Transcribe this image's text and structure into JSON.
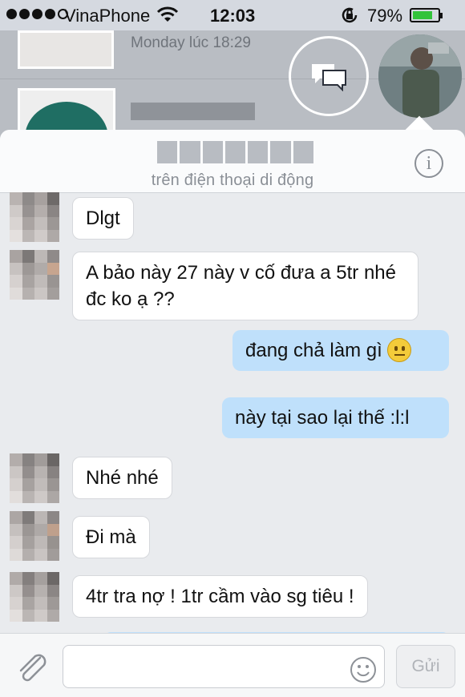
{
  "status_bar": {
    "carrier": "VinaPhone",
    "time": "12:03",
    "battery_percent": "79%",
    "battery_level": 0.79,
    "signal_bars_filled": 4
  },
  "background": {
    "date_label": "Monday lúc 18:29"
  },
  "chat": {
    "subtitle": "trên điện thoại di động",
    "messages": [
      {
        "direction": "in",
        "text": "Dlgt"
      },
      {
        "direction": "in",
        "text": "A bảo này 27 này v cố đưa a 5tr nhé đc ko ạ ??"
      },
      {
        "direction": "out",
        "text": "đang chả làm gì",
        "emoji": "neutral-face"
      },
      {
        "direction": "out",
        "text": "này tại sao lại thế :l:l"
      },
      {
        "direction": "in",
        "text": "Nhé nhé"
      },
      {
        "direction": "in",
        "text": "Đi mà"
      },
      {
        "direction": "in",
        "text": "4tr tra nợ ! 1tr cầm vào sg tiêu !"
      }
    ]
  },
  "composer": {
    "send_label": "Gửi"
  },
  "colors": {
    "outgoing_bubble": "#bfe0fb",
    "incoming_bubble": "#ffffff",
    "battery_fill": "#32c33a"
  }
}
